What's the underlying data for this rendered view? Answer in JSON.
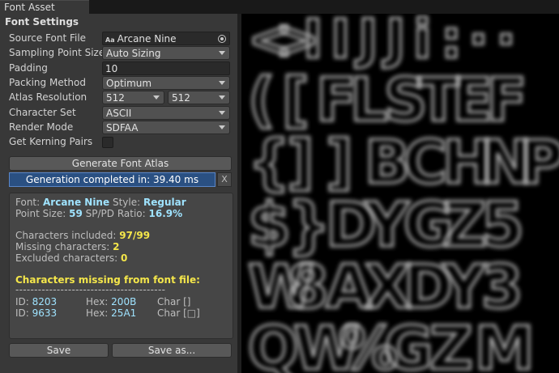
{
  "window": {
    "tab_title": "Font Asset Creator"
  },
  "settings": {
    "section_title": "Font Settings",
    "source_font_label": "Source Font File",
    "source_font_value": "Arcane Nine",
    "source_font_prefix": "Aa",
    "sampling_label": "Sampling Point Size",
    "sampling_value": "Auto Sizing",
    "padding_label": "Padding",
    "padding_value": "10",
    "packing_label": "Packing Method",
    "packing_value": "Optimum",
    "atlas_label": "Atlas Resolution",
    "atlas_width": "512",
    "atlas_height": "512",
    "charset_label": "Character Set",
    "charset_value": "ASCII",
    "render_label": "Render Mode",
    "render_value": "SDFAA",
    "kerning_label": "Get Kerning Pairs",
    "kerning_checked": false,
    "generate_label": "Generate Font Atlas",
    "progress_text": "Generation completed in: 39.40 ms",
    "progress_fraction": 1.0,
    "close_label": "X"
  },
  "info": {
    "font_label": "Font:",
    "font_value": "Arcane Nine",
    "style_label": "Style:",
    "style_value": "Regular",
    "point_size_label": "Point Size:",
    "point_size_value": "59",
    "ratio_label": "SP/PD Ratio:",
    "ratio_value": "16.9%",
    "included_label": "Characters included:",
    "included_value": "97/99",
    "missing_label": "Missing characters:",
    "missing_value": "2",
    "excluded_label": "Excluded characters:",
    "excluded_value": "0",
    "missing_header": "Characters missing from font file:",
    "separator": "----------------------------------------",
    "missing_rows": [
      {
        "id_label": "ID:",
        "id": "8203",
        "hex_label": "Hex:",
        "hex": "200B",
        "char_label": "Char",
        "char": "[]"
      },
      {
        "id_label": "ID:",
        "id": "9633",
        "hex_label": "Hex:",
        "hex": "25A1",
        "char_label": "Char",
        "char": "[□]"
      }
    ]
  },
  "footer": {
    "save_label": "Save",
    "save_as_label": "Save as..."
  },
  "atlas_rows": [
    [
      "<",
      ">",
      "I",
      "I",
      "J",
      "J",
      "i",
      ":",
      "·",
      "·"
    ],
    [
      "(",
      "[",
      "F",
      "L",
      "S",
      "T",
      "E",
      "F"
    ],
    [
      "{",
      "]",
      "]",
      "B",
      "C",
      "H",
      "N",
      "P"
    ],
    [
      "$",
      "}",
      "D",
      "Y",
      "G",
      "Z",
      "5"
    ],
    [
      "W",
      "8",
      "A",
      "X",
      "D",
      "Y",
      "3"
    ],
    [
      "Q",
      "W",
      "%",
      "G",
      "Z",
      "M"
    ]
  ],
  "colors": {
    "progress_fill": "#2a5082",
    "accent_cyan": "#9fe3ff",
    "accent_yellow": "#f4e64a"
  }
}
